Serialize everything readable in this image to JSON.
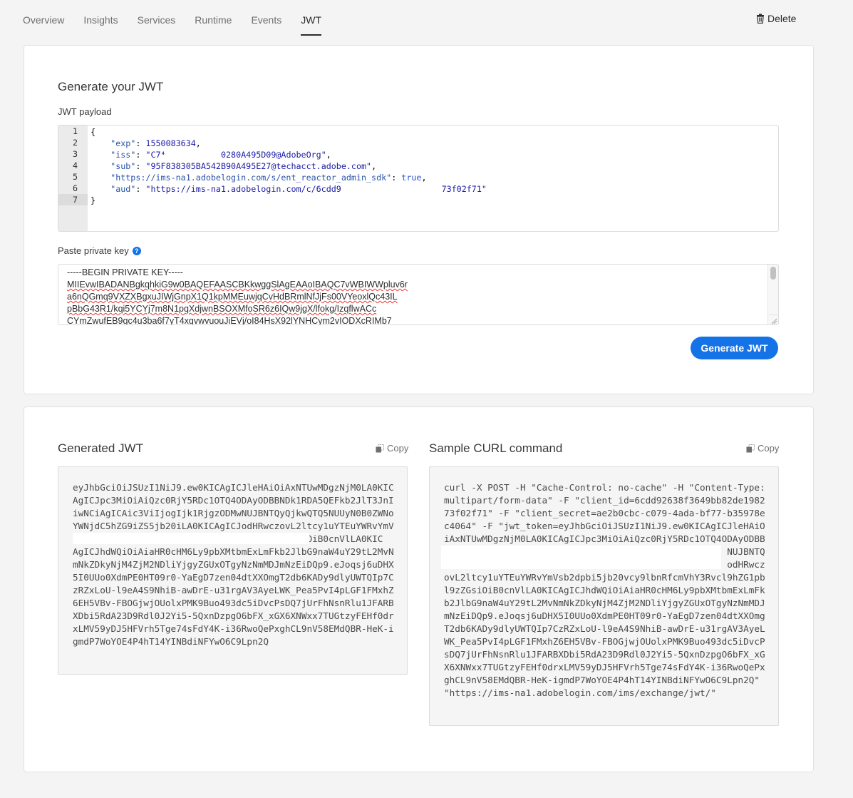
{
  "tabs": [
    {
      "label": "Overview"
    },
    {
      "label": "Insights"
    },
    {
      "label": "Services"
    },
    {
      "label": "Runtime"
    },
    {
      "label": "Events"
    },
    {
      "label": "JWT",
      "active": true
    }
  ],
  "delete_label": "Delete",
  "generate": {
    "title": "Generate your JWT",
    "payload_label": "JWT payload",
    "payload_lines": [
      [
        {
          "t": "p",
          "v": "{"
        }
      ],
      [
        {
          "t": "p",
          "v": "    "
        },
        {
          "t": "k",
          "v": "\"exp\""
        },
        {
          "t": "p",
          "v": ": "
        },
        {
          "t": "n",
          "v": "1550083634"
        },
        {
          "t": "p",
          "v": ","
        }
      ],
      [
        {
          "t": "p",
          "v": "    "
        },
        {
          "t": "k",
          "v": "\"iss\""
        },
        {
          "t": "p",
          "v": ": "
        },
        {
          "t": "s",
          "v": "\"C7⁴           0280A495D09@AdobeOrg\""
        },
        {
          "t": "p",
          "v": ","
        }
      ],
      [
        {
          "t": "p",
          "v": "    "
        },
        {
          "t": "k",
          "v": "\"sub\""
        },
        {
          "t": "p",
          "v": ": "
        },
        {
          "t": "s",
          "v": "\"95F838305BA542B90A495E27@techacct.adobe.com\""
        },
        {
          "t": "p",
          "v": ","
        }
      ],
      [
        {
          "t": "p",
          "v": "    "
        },
        {
          "t": "k",
          "v": "\"https://ims-na1.adobelogin.com/s/ent_reactor_admin_sdk\""
        },
        {
          "t": "p",
          "v": ": "
        },
        {
          "t": "b",
          "v": "true"
        },
        {
          "t": "p",
          "v": ","
        }
      ],
      [
        {
          "t": "p",
          "v": "    "
        },
        {
          "t": "k",
          "v": "\"aud\""
        },
        {
          "t": "p",
          "v": ": "
        },
        {
          "t": "s",
          "v": "\"https://ims-na1.adobelogin.com/c/6cdd9                    73f02f71\""
        }
      ],
      [
        {
          "t": "p",
          "v": "}"
        }
      ]
    ],
    "line_numbers": [
      "1",
      "2",
      "3",
      "4",
      "5",
      "6",
      "7"
    ],
    "private_key_label": "Paste private key",
    "private_key_lines": [
      "-----BEGIN PRIVATE KEY-----",
      "MIIEvwIBADANBgkqhkiG9w0BAQEFAASCBKkwggSlAgEAAoIBAQC7vWBIWWpluv6r",
      "a6nQGmq9VXZXBgxuJIWjGnpX1Q1kpMMEuwjqCvHdBRmlNfJjFs00VYeoxlQc43IL",
      "pBbG43R1/kqi5YCYj7m8N1pqXdjwnBSOXMfoSR6z6IQw9jgX/lfokg/IzqflwACc",
      "CYmZwufEB9gc4u3ba6f7yT4xgvwvuouJiEVj/oI84HsX92lYNHCym2vIODXcRIMb7"
    ],
    "button_label": "Generate JWT"
  },
  "output": {
    "jwt_title": "Generated JWT",
    "curl_title": "Sample CURL command",
    "copy_label": "Copy",
    "jwt_lines": [
      "eyJhbGciOiJSUzI1NiJ9.ew0KICAgICJleHAiOiAxNTUwMDgzNjM0LA0KIC",
      "AgICJpc3MiOiAiQzc0RjY5RDc1OTQ4ODAyODBBNDk1RDA5QEFkb2JlT3JnI",
      "iwNCiAgICAic3ViIjogIjk1RjgzODMwNUJBNTQyQjkwQTQ5NUUyN0B0ZWNo",
      "YWNjdC5hZG9iZS5jb20iLA0KICAgICJodHRwczovL2ltcy1uYTEuYWRvYmV",
      "                                          iOiB0cnVlLA0KIC",
      "AgICJhdWQiOiAiaHR0cHM6Ly9pbXMtbmExLmFkb2JlbG9naW4uY29tL2MvN",
      "mNkZDkyNjM4ZjM2NDliYjgyZGUxOTgyNzNmMDJmNzEiDQp9.eJoqsj6uDHX",
      "5I0UUo0XdmPE0HT09r0-YaEgD7zen04dtXXOmgT2db6KADy9dlyUWTQIp7C",
      "zRZxLoU-l9eA4S9NhiB-awDrE-u31rgAV3AyeLWK_Pea5PvI4pLGF1FMxhZ",
      "6EH5VBv-FBOGjwjOUolxPMK9Buo493dc5iDvcPsDQ7jUrFhNsnRlu1JFARB",
      "XDbi5RdA23D9Rdl0J2Yi5-5QxnDzpgO6bFX_xGX6XNWxx7TUGtzyFEHf0dr",
      "xLMV59yDJ5HFVrh5Tge74sFdY4K-i36RwoQePxghCL9nV58EMdQBR-HeK-i",
      "gmdP7WoYOE4P4hT14YINBdiNFYwO6C9Lpn2Q"
    ],
    "curl_lines": [
      "curl -X POST -H \"Cache-Control: no-cache\" -H \"Content-Type:",
      "multipart/form-data\" -F \"client_id=6cdd92638f3649bb82de1982",
      "73f02f71\" -F \"client_secret=ae2b0cbc-c079-4ada-bf77-b35978e",
      "c4064\" -F \"jwt_token=eyJhbGciOiJSUzI1NiJ9.ew0KICAgICJleHAiO",
      "iAxNTUwMDgzNjM0LA0KICAgICJpc3MiOiAiQzc0RjY5RDc1OTQ4ODAyODBB",
      "                                                    NUJBNTQ",
      "                                                    odHRwcz",
      "ovL2ltcy1uYTEuYWRvYmVsb2dpbi5jb20vcy9lbnRfcmVhY3Rvcl9hZG1pb",
      "l9zZGsiOiB0cnVlLA0KICAgICJhdWQiOiAiaHR0cHM6Ly9pbXMtbmExLmFk",
      "b2JlbG9naW4uY29tL2MvNmNkZDkyNjM4ZjM2NDliYjgyZGUxOTgyNzNmMDJ",
      "mNzEiDQp9.eJoqsj6uDHX5I0UUo0XdmPE0HT09r0-YaEgD7zen04dtXXOmg",
      "T2db6KADy9dlyUWTQIp7CzRZxLoU-l9eA4S9NhiB-awDrE-u31rgAV3AyeL",
      "WK_Pea5PvI4pLGF1FMxhZ6EH5VBv-FBOGjwjOUolxPMK9Buo493dc5iDvcP",
      "sDQ7jUrFhNsnRlu1JFARBXDbi5RdA23D9Rdl0J2Yi5-5QxnDzpgO6bFX_xG",
      "X6XNWxx7TUGtzyFEHf0drxLMV59yDJ5HFVrh5Tge74sFdY4K-i36RwoQePx",
      "ghCL9nV58EMdQBR-HeK-igmdP7WoYOE4P4hT14YINBdiNFYwO6C9Lpn2Q\"",
      "\"https://ims-na1.adobelogin.com/ims/exchange/jwt/\""
    ]
  },
  "colors": {
    "accent": "#1473e6",
    "background": "#f4f4f4"
  }
}
